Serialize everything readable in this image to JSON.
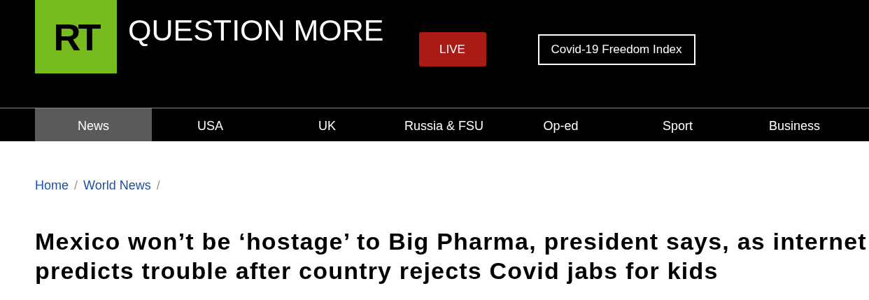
{
  "header": {
    "logo": "RT",
    "tagline": "QUESTION MORE",
    "live_button": "LIVE",
    "index_button": "Covid-19 Freedom Index"
  },
  "nav": [
    {
      "label": "News",
      "selected": true
    },
    {
      "label": "USA",
      "selected": false
    },
    {
      "label": "UK",
      "selected": false
    },
    {
      "label": "Russia & FSU",
      "selected": false
    },
    {
      "label": "Op-ed",
      "selected": false
    },
    {
      "label": "Sport",
      "selected": false
    },
    {
      "label": "Business",
      "selected": false
    }
  ],
  "breadcrumb": [
    {
      "label": "Home",
      "separator": "/"
    },
    {
      "label": "World News",
      "separator": "/"
    }
  ],
  "headline": "Mexico won’t be ‘hostage’ to Big Pharma, president says, as internet predicts trouble after country rejects Covid jabs for kids"
}
